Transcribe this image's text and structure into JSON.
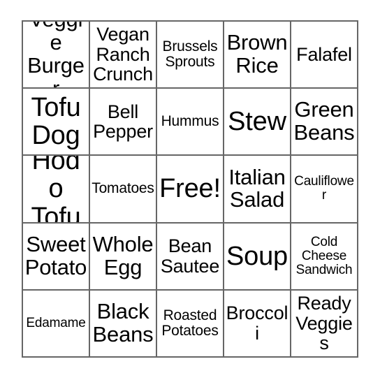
{
  "card": {
    "type": "bingo-card",
    "columns": 5,
    "rows": 5,
    "border_color": "#666666",
    "background_color": "#ffffff",
    "text_color": "#000000",
    "cells": [
      {
        "text": "Veggie Burger",
        "size": "lg"
      },
      {
        "text": "Vegan Ranch Crunch",
        "size": "md"
      },
      {
        "text": "Brussels Sprouts",
        "size": "sm"
      },
      {
        "text": "Brown Rice",
        "size": "lg"
      },
      {
        "text": "Falafel",
        "size": "md"
      },
      {
        "text": "Tofu Dog",
        "size": "xl"
      },
      {
        "text": "Bell Pepper",
        "size": "md"
      },
      {
        "text": "Hummus",
        "size": "sm"
      },
      {
        "text": "Stew",
        "size": "xl"
      },
      {
        "text": "Green Beans",
        "size": "lg"
      },
      {
        "text": "Hodo Tofu",
        "size": "xl"
      },
      {
        "text": "Tomatoes",
        "size": "sm"
      },
      {
        "text": "Free!",
        "size": "xl"
      },
      {
        "text": "Italian Salad",
        "size": "lg"
      },
      {
        "text": "Cauliflower",
        "size": "xs"
      },
      {
        "text": "Sweet Potato",
        "size": "lg"
      },
      {
        "text": "Whole Egg",
        "size": "lg"
      },
      {
        "text": "Bean Sautee",
        "size": "md"
      },
      {
        "text": "Soup",
        "size": "xl"
      },
      {
        "text": "Cold Cheese Sandwich",
        "size": "xs"
      },
      {
        "text": "Edamame",
        "size": "xs"
      },
      {
        "text": "Black Beans",
        "size": "lg"
      },
      {
        "text": "Roasted Potatoes",
        "size": "sm"
      },
      {
        "text": "Broccoli",
        "size": "md"
      },
      {
        "text": "Ready Veggies",
        "size": "md"
      }
    ]
  }
}
